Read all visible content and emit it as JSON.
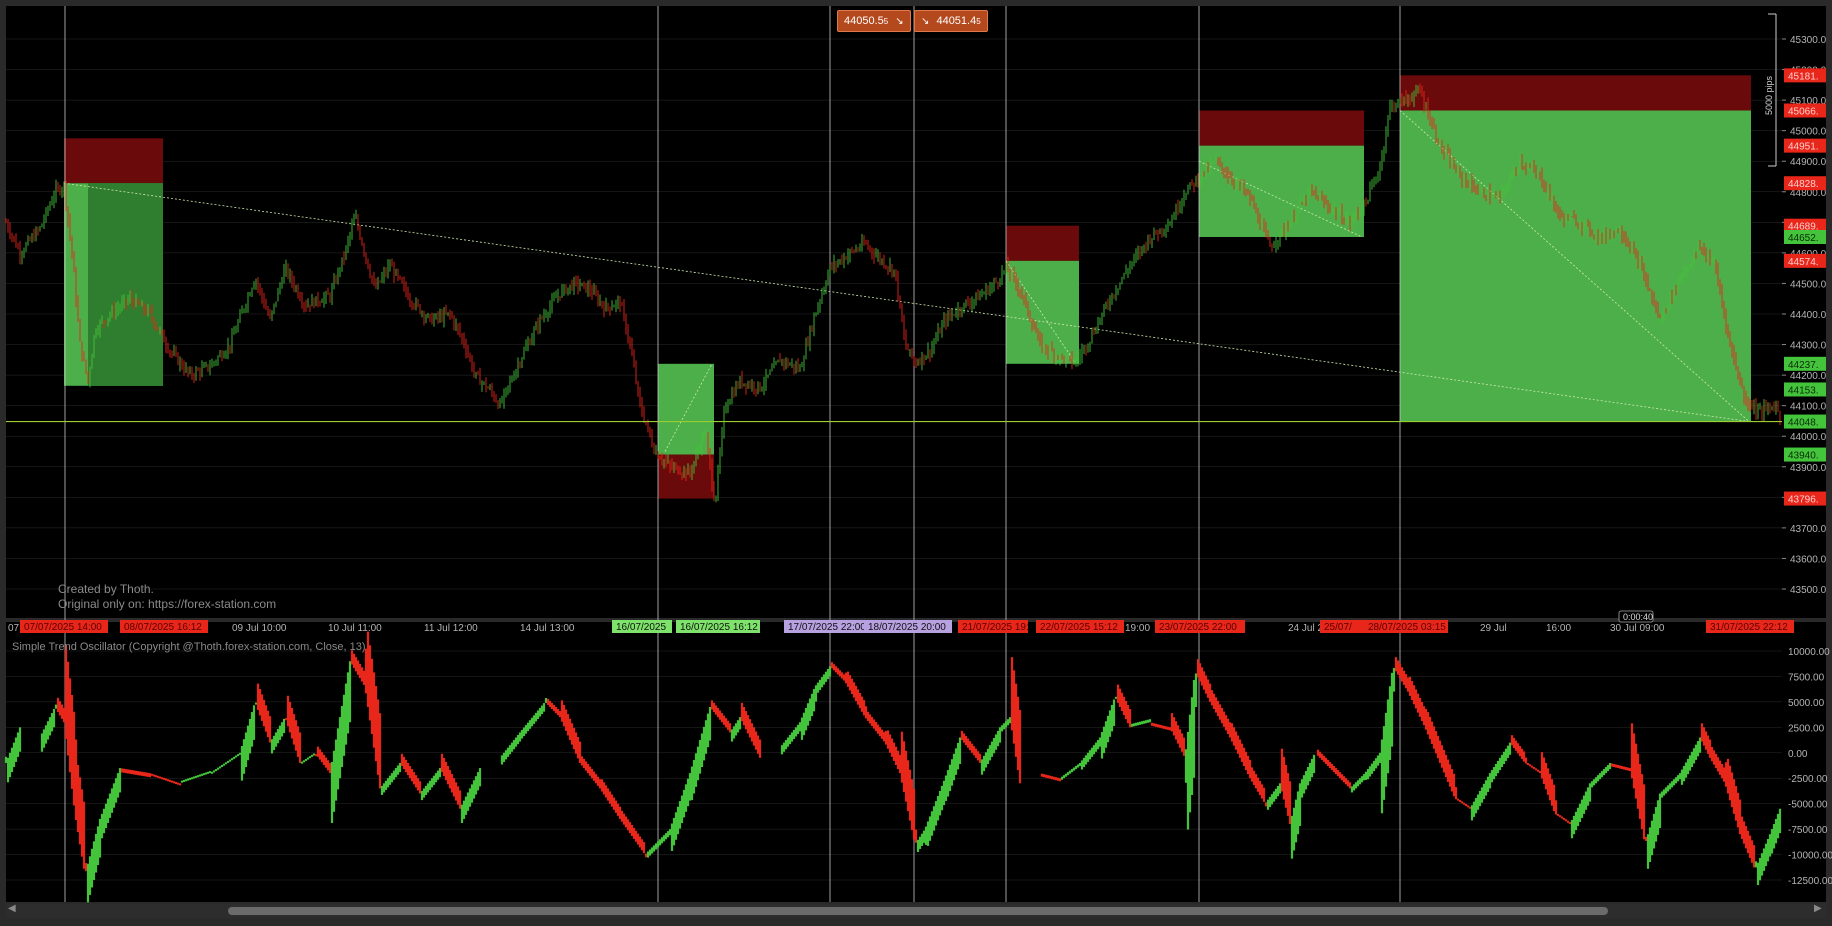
{
  "orders": {
    "sell_label": "44050.5",
    "sell_sub": "5",
    "buy_label": "44051.4",
    "buy_sub": "5"
  },
  "watermark": {
    "line1": "Created by Thoth.",
    "line2": "Original only on: https://forex-station.com"
  },
  "oscillator": {
    "title": "Simple Trend Oscillator (Copyright @Thoth.forex-station.com, Close, 13)"
  },
  "price_axis": {
    "ticks": [
      "45300.0",
      "45200.0",
      "45100.0",
      "45000.0",
      "44900.0",
      "44800.0",
      "44700.0",
      "44600.0",
      "44500.0",
      "44400.0",
      "44300.0",
      "44200.0",
      "44100.0",
      "44000.0",
      "43900.0",
      "43800.0",
      "43700.0",
      "43600.0",
      "43500.0"
    ],
    "badges": [
      {
        "text": "45181.",
        "kind": "red"
      },
      {
        "text": "45066.",
        "kind": "red"
      },
      {
        "text": "44951.",
        "kind": "red"
      },
      {
        "text": "44828.",
        "kind": "red"
      },
      {
        "text": "44689.",
        "kind": "red"
      },
      {
        "text": "44652.",
        "kind": "green"
      },
      {
        "text": "44574.",
        "kind": "red"
      },
      {
        "text": "44237.",
        "kind": "green"
      },
      {
        "text": "44153.",
        "kind": "green"
      },
      {
        "text": "44048.",
        "kind": "green"
      },
      {
        "text": "43940.",
        "kind": "green"
      },
      {
        "text": "43796.",
        "kind": "red"
      }
    ],
    "pips_label": "5000 pips"
  },
  "osc_axis": {
    "ticks": [
      "10000.00",
      "7500.00",
      "5000.00",
      "2500.00",
      "0.00",
      "-2500.00",
      "-5000.00",
      "-7500.00",
      "-10000.00",
      "-12500.00"
    ]
  },
  "time_axis": {
    "labels": [
      "07",
      "09 Jul 10:00",
      "10 Jul 11:00",
      "11 Jul 12:00",
      "14 Jul 13:00",
      "19:00",
      "24 Jul 2",
      "29 Jul",
      "16:00",
      "30 Jul 09:00",
      "3"
    ],
    "tags": [
      {
        "text": "07/07/2025 14:00",
        "kind": "red"
      },
      {
        "text": "08/07/2025 16:12",
        "kind": "red"
      },
      {
        "text": "16/07/2025",
        "kind": "green"
      },
      {
        "text": "16/07/2025 16:12",
        "kind": "green"
      },
      {
        "text": "17/07/2025 22:00",
        "kind": "purple"
      },
      {
        "text": "18/07/2025 20:00",
        "kind": "purple"
      },
      {
        "text": "21/07/2025 19:",
        "kind": "red"
      },
      {
        "text": "22/07/2025 15:12",
        "kind": "red"
      },
      {
        "text": "23/07/2025 22:00",
        "kind": "red"
      },
      {
        "text": "25/07/",
        "kind": "red"
      },
      {
        "text": "28/07/2025 03:15",
        "kind": "red"
      },
      {
        "text": "31/07/2025 22:12",
        "kind": "red"
      }
    ],
    "timer": "0:00:40"
  },
  "colors": {
    "bull": "#44c43a",
    "bear": "#e8261a",
    "zone_green": "#4caf4a",
    "zone_red": "#6a0a0a",
    "hline": "#9acd32",
    "bg": "#000000",
    "grid": "#2b2b2b",
    "vline": "#c8c8c8",
    "axis_text": "#b4b4b4"
  },
  "icons": {
    "scroll_left": "triangle-left-icon",
    "scroll_right": "triangle-right-icon"
  }
}
